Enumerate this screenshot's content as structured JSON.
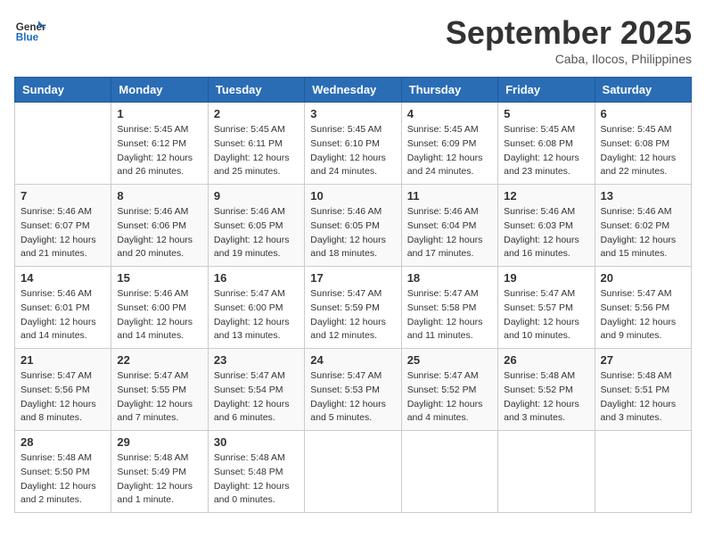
{
  "header": {
    "logo_general": "General",
    "logo_blue": "Blue",
    "month_title": "September 2025",
    "location": "Caba, Ilocos, Philippines"
  },
  "calendar": {
    "days_of_week": [
      "Sunday",
      "Monday",
      "Tuesday",
      "Wednesday",
      "Thursday",
      "Friday",
      "Saturday"
    ],
    "weeks": [
      [
        {
          "day": "",
          "sunrise": "",
          "sunset": "",
          "daylight": ""
        },
        {
          "day": "1",
          "sunrise": "Sunrise: 5:45 AM",
          "sunset": "Sunset: 6:12 PM",
          "daylight": "Daylight: 12 hours and 26 minutes."
        },
        {
          "day": "2",
          "sunrise": "Sunrise: 5:45 AM",
          "sunset": "Sunset: 6:11 PM",
          "daylight": "Daylight: 12 hours and 25 minutes."
        },
        {
          "day": "3",
          "sunrise": "Sunrise: 5:45 AM",
          "sunset": "Sunset: 6:10 PM",
          "daylight": "Daylight: 12 hours and 24 minutes."
        },
        {
          "day": "4",
          "sunrise": "Sunrise: 5:45 AM",
          "sunset": "Sunset: 6:09 PM",
          "daylight": "Daylight: 12 hours and 24 minutes."
        },
        {
          "day": "5",
          "sunrise": "Sunrise: 5:45 AM",
          "sunset": "Sunset: 6:08 PM",
          "daylight": "Daylight: 12 hours and 23 minutes."
        },
        {
          "day": "6",
          "sunrise": "Sunrise: 5:45 AM",
          "sunset": "Sunset: 6:08 PM",
          "daylight": "Daylight: 12 hours and 22 minutes."
        }
      ],
      [
        {
          "day": "7",
          "sunrise": "Sunrise: 5:46 AM",
          "sunset": "Sunset: 6:07 PM",
          "daylight": "Daylight: 12 hours and 21 minutes."
        },
        {
          "day": "8",
          "sunrise": "Sunrise: 5:46 AM",
          "sunset": "Sunset: 6:06 PM",
          "daylight": "Daylight: 12 hours and 20 minutes."
        },
        {
          "day": "9",
          "sunrise": "Sunrise: 5:46 AM",
          "sunset": "Sunset: 6:05 PM",
          "daylight": "Daylight: 12 hours and 19 minutes."
        },
        {
          "day": "10",
          "sunrise": "Sunrise: 5:46 AM",
          "sunset": "Sunset: 6:05 PM",
          "daylight": "Daylight: 12 hours and 18 minutes."
        },
        {
          "day": "11",
          "sunrise": "Sunrise: 5:46 AM",
          "sunset": "Sunset: 6:04 PM",
          "daylight": "Daylight: 12 hours and 17 minutes."
        },
        {
          "day": "12",
          "sunrise": "Sunrise: 5:46 AM",
          "sunset": "Sunset: 6:03 PM",
          "daylight": "Daylight: 12 hours and 16 minutes."
        },
        {
          "day": "13",
          "sunrise": "Sunrise: 5:46 AM",
          "sunset": "Sunset: 6:02 PM",
          "daylight": "Daylight: 12 hours and 15 minutes."
        }
      ],
      [
        {
          "day": "14",
          "sunrise": "Sunrise: 5:46 AM",
          "sunset": "Sunset: 6:01 PM",
          "daylight": "Daylight: 12 hours and 14 minutes."
        },
        {
          "day": "15",
          "sunrise": "Sunrise: 5:46 AM",
          "sunset": "Sunset: 6:00 PM",
          "daylight": "Daylight: 12 hours and 14 minutes."
        },
        {
          "day": "16",
          "sunrise": "Sunrise: 5:47 AM",
          "sunset": "Sunset: 6:00 PM",
          "daylight": "Daylight: 12 hours and 13 minutes."
        },
        {
          "day": "17",
          "sunrise": "Sunrise: 5:47 AM",
          "sunset": "Sunset: 5:59 PM",
          "daylight": "Daylight: 12 hours and 12 minutes."
        },
        {
          "day": "18",
          "sunrise": "Sunrise: 5:47 AM",
          "sunset": "Sunset: 5:58 PM",
          "daylight": "Daylight: 12 hours and 11 minutes."
        },
        {
          "day": "19",
          "sunrise": "Sunrise: 5:47 AM",
          "sunset": "Sunset: 5:57 PM",
          "daylight": "Daylight: 12 hours and 10 minutes."
        },
        {
          "day": "20",
          "sunrise": "Sunrise: 5:47 AM",
          "sunset": "Sunset: 5:56 PM",
          "daylight": "Daylight: 12 hours and 9 minutes."
        }
      ],
      [
        {
          "day": "21",
          "sunrise": "Sunrise: 5:47 AM",
          "sunset": "Sunset: 5:56 PM",
          "daylight": "Daylight: 12 hours and 8 minutes."
        },
        {
          "day": "22",
          "sunrise": "Sunrise: 5:47 AM",
          "sunset": "Sunset: 5:55 PM",
          "daylight": "Daylight: 12 hours and 7 minutes."
        },
        {
          "day": "23",
          "sunrise": "Sunrise: 5:47 AM",
          "sunset": "Sunset: 5:54 PM",
          "daylight": "Daylight: 12 hours and 6 minutes."
        },
        {
          "day": "24",
          "sunrise": "Sunrise: 5:47 AM",
          "sunset": "Sunset: 5:53 PM",
          "daylight": "Daylight: 12 hours and 5 minutes."
        },
        {
          "day": "25",
          "sunrise": "Sunrise: 5:47 AM",
          "sunset": "Sunset: 5:52 PM",
          "daylight": "Daylight: 12 hours and 4 minutes."
        },
        {
          "day": "26",
          "sunrise": "Sunrise: 5:48 AM",
          "sunset": "Sunset: 5:52 PM",
          "daylight": "Daylight: 12 hours and 3 minutes."
        },
        {
          "day": "27",
          "sunrise": "Sunrise: 5:48 AM",
          "sunset": "Sunset: 5:51 PM",
          "daylight": "Daylight: 12 hours and 3 minutes."
        }
      ],
      [
        {
          "day": "28",
          "sunrise": "Sunrise: 5:48 AM",
          "sunset": "Sunset: 5:50 PM",
          "daylight": "Daylight: 12 hours and 2 minutes."
        },
        {
          "day": "29",
          "sunrise": "Sunrise: 5:48 AM",
          "sunset": "Sunset: 5:49 PM",
          "daylight": "Daylight: 12 hours and 1 minute."
        },
        {
          "day": "30",
          "sunrise": "Sunrise: 5:48 AM",
          "sunset": "Sunset: 5:48 PM",
          "daylight": "Daylight: 12 hours and 0 minutes."
        },
        {
          "day": "",
          "sunrise": "",
          "sunset": "",
          "daylight": ""
        },
        {
          "day": "",
          "sunrise": "",
          "sunset": "",
          "daylight": ""
        },
        {
          "day": "",
          "sunrise": "",
          "sunset": "",
          "daylight": ""
        },
        {
          "day": "",
          "sunrise": "",
          "sunset": "",
          "daylight": ""
        }
      ]
    ]
  }
}
